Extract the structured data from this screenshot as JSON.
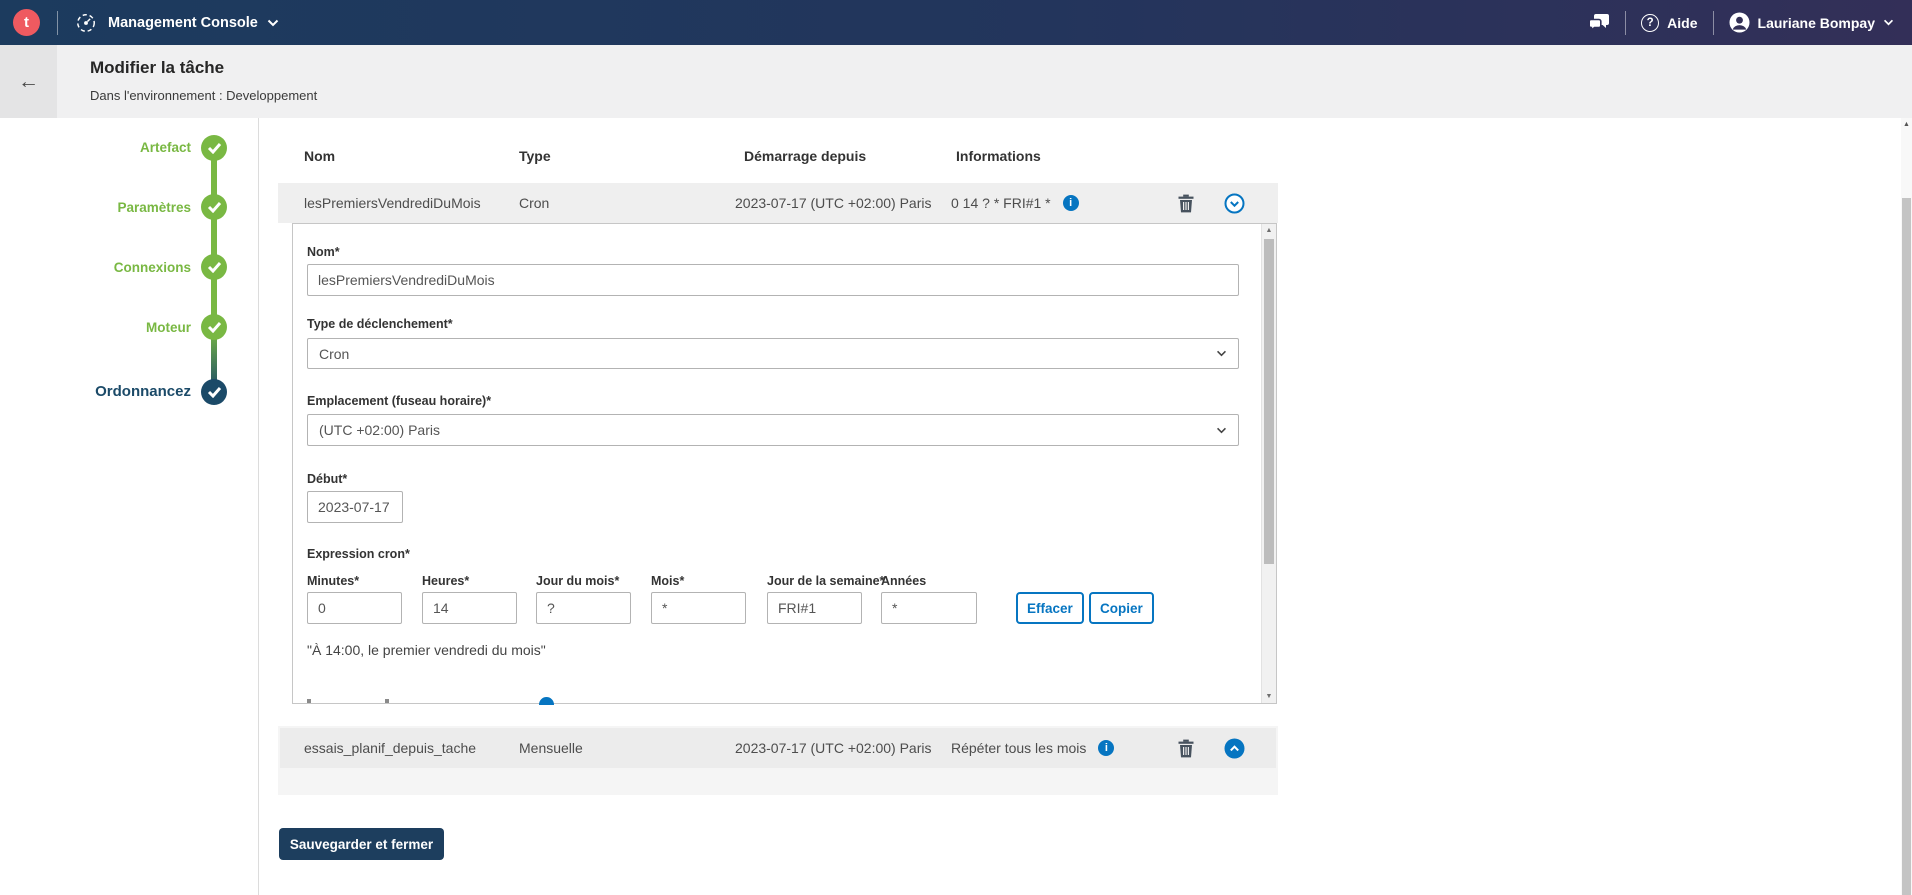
{
  "colors": {
    "navbar_left": "#1c3b5e",
    "navbar_right": "#332f58",
    "logo_coral": "#ef5a60",
    "accent_blue": "#0675c1",
    "step_green": "#79b843",
    "step_navy": "#1b4a68",
    "save_button_bg": "#1d3e5e",
    "row_gray": "#efefef"
  },
  "icons": {
    "back_arrow": "←",
    "scroll_up": "▲",
    "scroll_down": "▼",
    "info_glyph": "i",
    "help_glyph": "?"
  },
  "navbar": {
    "logo_letter": "t",
    "product": "Management Console",
    "help_label": "Aide",
    "user_name": "Lauriane Bompay"
  },
  "header": {
    "title": "Modifier la tâche",
    "subtitle": "Dans l'environnement : Developpement"
  },
  "stepper": {
    "steps": [
      {
        "label": "Artefact",
        "state": "done"
      },
      {
        "label": "Paramètres",
        "state": "done"
      },
      {
        "label": "Connexions",
        "state": "done"
      },
      {
        "label": "Moteur",
        "state": "done"
      },
      {
        "label": "Ordonnancez",
        "state": "current"
      }
    ]
  },
  "table": {
    "columns": [
      "Nom",
      "Type",
      "Démarrage depuis",
      "Informations"
    ],
    "rows": [
      {
        "name": "lesPremiersVendrediDuMois",
        "type": "Cron",
        "start": "2023-07-17 (UTC +02:00) Paris",
        "info": "0 14 ? * FRI#1 *",
        "expanded": true
      },
      {
        "name": "essais_planif_depuis_tache",
        "type": "Mensuelle",
        "start": "2023-07-17 (UTC +02:00) Paris",
        "info": "Répéter tous les mois",
        "expanded": false
      }
    ]
  },
  "form": {
    "name_label": "Nom*",
    "name_value": "lesPremiersVendrediDuMois",
    "trigger_label": "Type de déclenchement*",
    "trigger_value": "Cron",
    "timezone_label": "Emplacement (fuseau horaire)*",
    "timezone_value": "(UTC +02:00) Paris",
    "start_label": "Début*",
    "start_value": "2023-07-17",
    "cron_section_label": "Expression cron*",
    "cron_fields": [
      {
        "label": "Minutes*",
        "value": "0"
      },
      {
        "label": "Heures*",
        "value": "14"
      },
      {
        "label": "Jour du mois*",
        "value": "?"
      },
      {
        "label": "Mois*",
        "value": "*"
      },
      {
        "label": "Jour de la semaine*",
        "value": "FRI#1"
      },
      {
        "label": "Années",
        "value": "*"
      }
    ],
    "clear_button": "Effacer",
    "copy_button": "Copier",
    "cron_description": "\"À 14:00, le premier vendredi du mois\""
  },
  "footer": {
    "save_button": "Sauvegarder et fermer"
  }
}
